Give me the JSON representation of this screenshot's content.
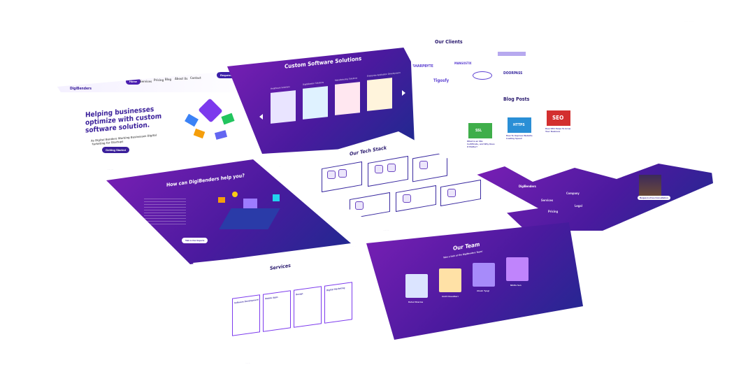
{
  "hero": {
    "brand": "DigiBenders",
    "nav": [
      "Home",
      "Services",
      "Pricing",
      "Blog",
      "About Us",
      "Contact"
    ],
    "cta": "Request Free Consultation",
    "headline": "Helping businesses optimize with custom software solution.",
    "sub": "As Digital Benders Working Businesses Digital Marketing for Startups",
    "button": "Getting Started"
  },
  "solutions": {
    "title": "Custom Software Solutions",
    "items": [
      "Healthcare Solutions",
      "Digitalization Solutions",
      "Manufacturing Solutions",
      "Enterprise Application Development"
    ]
  },
  "clients": {
    "title": "Our Clients",
    "logos": [
      "SHARPBYTE",
      "MANGOSTIX",
      "",
      "Tigosfy",
      "",
      "DOORPASS"
    ]
  },
  "blog": {
    "title": "Blog Posts",
    "cards": [
      "SSL",
      "HTTPS",
      "SEO"
    ],
    "captions": [
      "What is an SSL Certificate, and Why Does it Matter?",
      "How To Improve Website Loading Speed",
      "How SEO Helps To Grow Your Business"
    ]
  },
  "help": {
    "title": "How can DigiBenders help you?",
    "button": "Talk to Our Experts"
  },
  "techstack": {
    "title": "Our Tech Stack"
  },
  "footer": {
    "brand": "DigiBenders",
    "cols": [
      "Services",
      "Company",
      "Pricing",
      "Legal"
    ],
    "cta": "Request a Free Consultation"
  },
  "services": {
    "title": "Services",
    "items": [
      "Software Development",
      "Mobile Apps",
      "Design",
      "Digital Marketing"
    ]
  },
  "team": {
    "title": "Our Team",
    "sub": "Take a look at the DigiBenders Team!",
    "members": [
      {
        "name": "Rahul Sharma",
        "role": "CEO & Co-Founder"
      },
      {
        "name": "Amit Chaudhari",
        "role": "Founder"
      },
      {
        "name": "Akash Tyagi",
        "role": "Developer"
      },
      {
        "name": "Nikita Sen",
        "role": "Designer"
      }
    ]
  },
  "colors": {
    "purple": "#6b1fb0",
    "navy": "#1d2a8f",
    "accent": "#7c3aed"
  }
}
